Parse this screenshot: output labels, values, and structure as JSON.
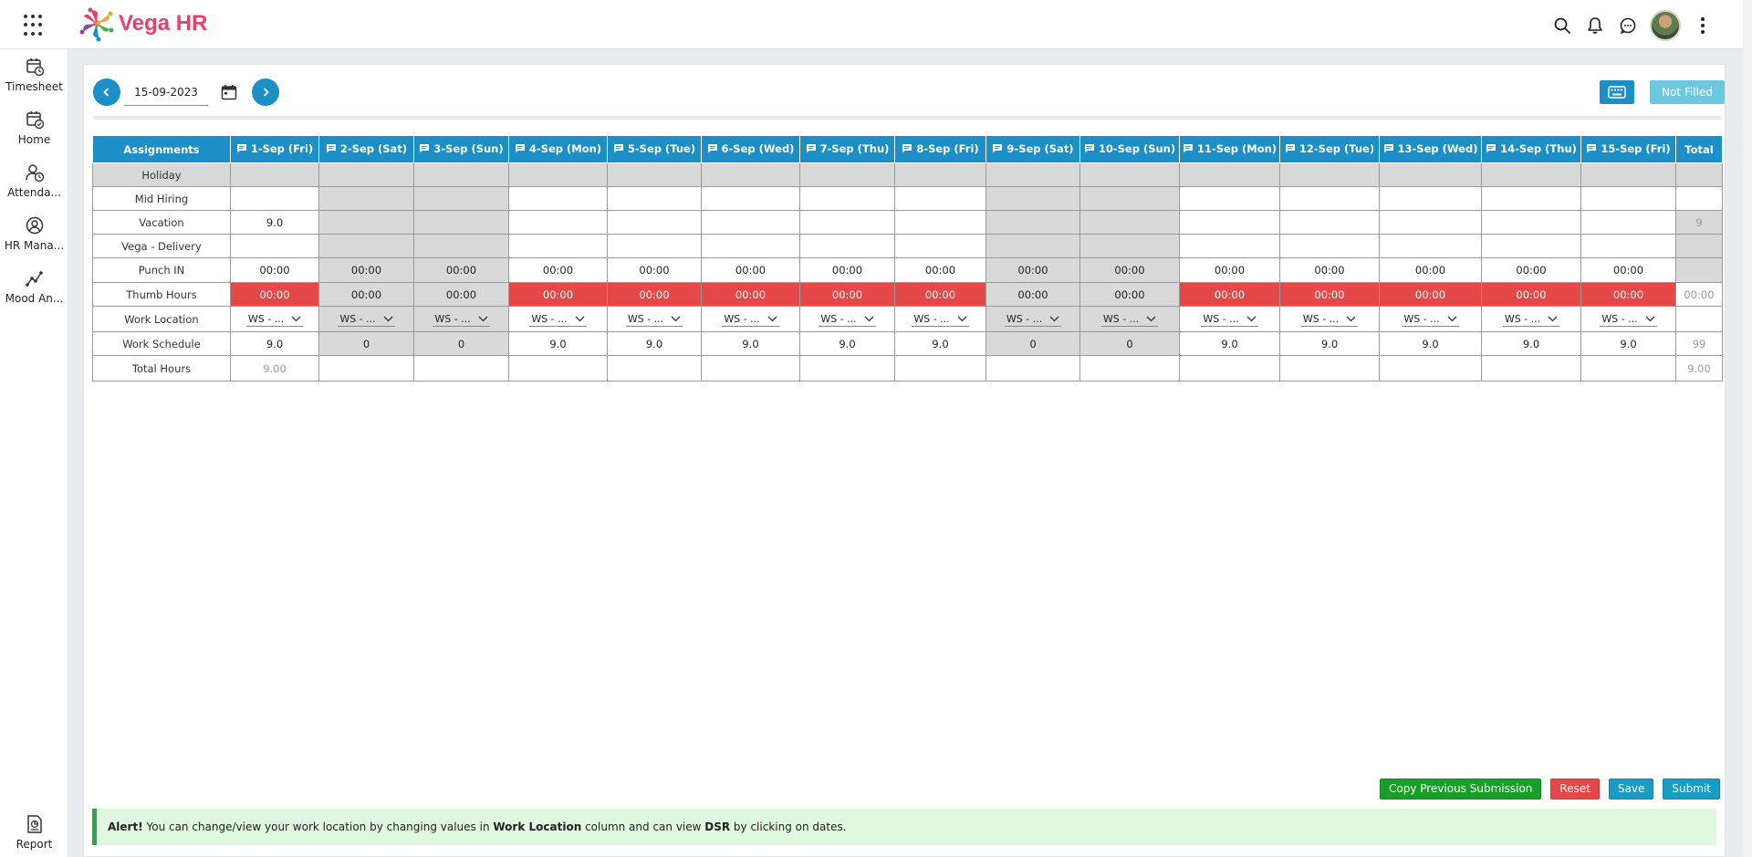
{
  "app": {
    "name": "Vega HR"
  },
  "sidebar": {
    "items": [
      {
        "label": "Timesheet",
        "icon": "timesheet-icon"
      },
      {
        "label": "Home",
        "icon": "calendar-check-icon"
      },
      {
        "label": "Attenda...",
        "icon": "user-clock-icon"
      },
      {
        "label": "HR Mana...",
        "icon": "hr-manager-icon"
      },
      {
        "label": "Mood An...",
        "icon": "trend-line-icon"
      },
      {
        "label": "Report",
        "icon": "report-icon"
      }
    ]
  },
  "toolbar": {
    "date_value": "15-09-2023",
    "status_label": "Not Filled"
  },
  "table": {
    "corner_label": "Assignments",
    "total_label": "Total",
    "columns": [
      "1-Sep (Fri)",
      "2-Sep (Sat)",
      "3-Sep (Sun)",
      "4-Sep (Mon)",
      "5-Sep (Tue)",
      "6-Sep (Wed)",
      "7-Sep (Thu)",
      "8-Sep (Fri)",
      "9-Sep (Sat)",
      "10-Sep (Sun)",
      "11-Sep (Mon)",
      "12-Sep (Tue)",
      "13-Sep (Wed)",
      "14-Sep (Thu)",
      "15-Sep (Fri)"
    ],
    "rows": {
      "holiday": {
        "label": "Holiday"
      },
      "mid_hiring": {
        "label": "Mid Hiring"
      },
      "vacation": {
        "label": "Vacation",
        "first_value": "9.0",
        "total": "9"
      },
      "vega_delivery": {
        "label": "Vega - Delivery"
      },
      "punch_in": {
        "label": "Punch IN",
        "value": "00:00"
      },
      "thumb_hours": {
        "label": "Thumb Hours",
        "value": "00:00",
        "total": "00:00"
      },
      "work_location": {
        "label": "Work Location",
        "value": "WS - ..."
      },
      "work_schedule": {
        "label": "Work Schedule",
        "values": [
          "9.0",
          "0",
          "0",
          "9.0",
          "9.0",
          "9.0",
          "9.0",
          "9.0",
          "0",
          "0",
          "9.0",
          "9.0",
          "9.0",
          "9.0",
          "9.0"
        ],
        "total": "99"
      },
      "total_hours": {
        "label": "Total Hours",
        "first_value": "9.00",
        "total": "9.00"
      }
    }
  },
  "actions": {
    "copy_label": "Copy Previous Submission",
    "reset_label": "Reset",
    "save_label": "Save",
    "submit_label": "Submit"
  },
  "alert": {
    "prefix": "Alert!",
    "text1": " You can change/view your work location by changing values in ",
    "bold1": "Work Location",
    "text2": " column and can view ",
    "bold2": "DSR",
    "text3": " by clicking on dates."
  },
  "colors": {
    "primary": "#1b8fc6",
    "red": "#e54848",
    "green": "#1a9e2a",
    "brand": "#e5416a",
    "alert_bg": "#dff8df"
  }
}
